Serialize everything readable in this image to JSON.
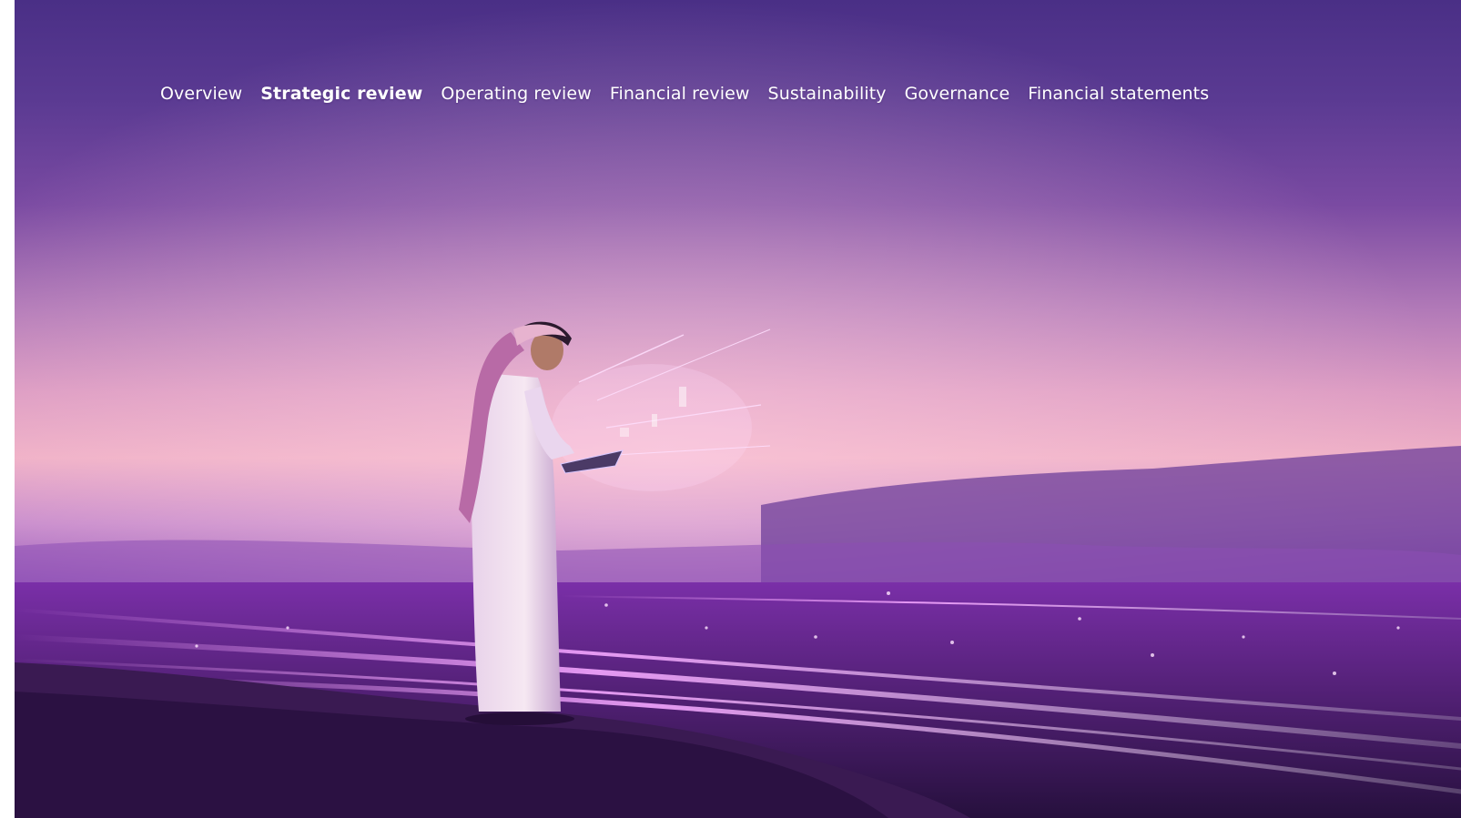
{
  "nav": {
    "items": [
      {
        "label": "Overview",
        "active": false
      },
      {
        "label": "Strategic review",
        "active": true
      },
      {
        "label": "Operating review",
        "active": false
      },
      {
        "label": "Financial review",
        "active": false
      },
      {
        "label": "Sustainability",
        "active": false
      },
      {
        "label": "Governance",
        "active": false
      },
      {
        "label": "Financial statements",
        "active": false
      }
    ]
  },
  "hero": {
    "image": "man-with-tablet-purple-city-horizon"
  },
  "colors": {
    "nav_text": "#ffffff",
    "sky_top": "#4a2f86",
    "horizon_glow": "#efb0c6",
    "light_streaks": "#e880f0"
  }
}
